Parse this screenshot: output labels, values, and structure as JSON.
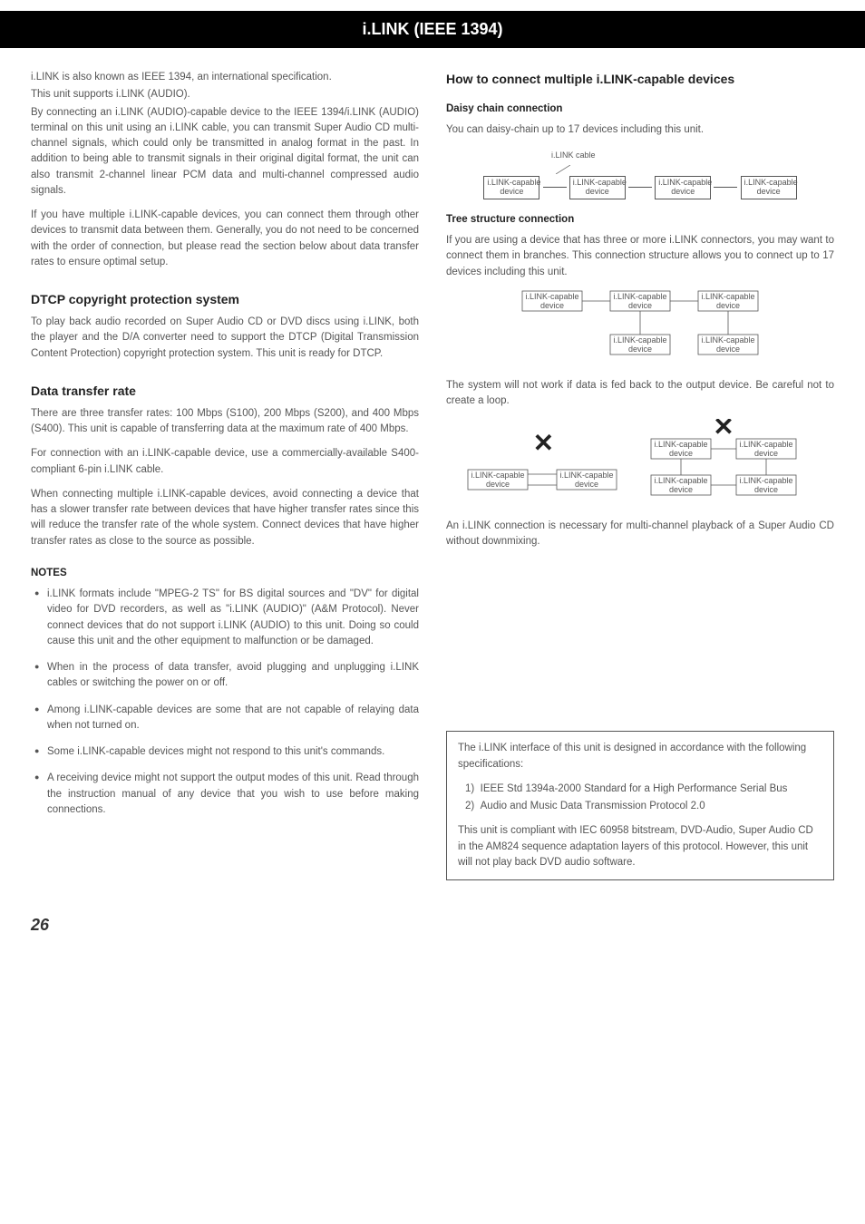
{
  "header": {
    "title": "i.LINK (IEEE 1394)"
  },
  "page_number": "26",
  "left": {
    "intro": [
      "i.LINK is also known as IEEE 1394, an international specification.",
      "This unit supports i.LINK (AUDIO).",
      "By connecting an i.LINK (AUDIO)-capable device to the IEEE 1394/i.LINK (AUDIO) terminal on this unit using an i.LINK cable, you can transmit Super Audio CD multi-channel signals, which could only be transmitted in analog format in the past. In addition to being able to transmit signals in their original digital format, the unit can also transmit 2-channel linear PCM data and multi-channel compressed audio signals.",
      "If you have multiple i.LINK-capable devices, you can connect them through other devices to transmit data between them. Generally, you do not need to be concerned with the order of connection, but please read the section below about data transfer rates to ensure optimal setup."
    ],
    "h_dtcp": "DTCP copyright protection system",
    "p_dtcp": "To play back audio recorded on Super Audio CD or DVD discs using i.LINK, both the player and the D/A converter need to support the DTCP (Digital Transmission Content Protection) copyright protection system. This unit is ready for DTCP.",
    "h_rate": "Data transfer rate",
    "p_rate_1": "There are three transfer rates: 100 Mbps (S100), 200 Mbps (S200), and 400 Mbps (S400). This unit is capable of transferring data at the maximum rate of 400 Mbps.",
    "p_rate_2": "For connection with an i.LINK-capable device, use a commercially-available S400-compliant 6-pin i.LINK cable.",
    "p_rate_3": "When connecting multiple i.LINK-capable devices, avoid connecting a device that has a slower transfer rate between devices that have higher transfer rates since this will reduce the transfer rate of the whole system. Connect devices that have higher transfer rates as close to the source as possible.",
    "notes_head": "NOTES",
    "notes": [
      "i.LINK formats include \"MPEG-2 TS\" for BS digital sources and \"DV\" for digital video for DVD recorders, as well as \"i.LINK (AUDIO)\" (A&M Protocol). Never connect devices that do not support i.LINK (AUDIO) to this unit. Doing so could cause this unit and the other equipment to malfunction or be damaged.",
      "When in the process of data transfer, avoid plugging and unplugging i.LINK cables or switching the power on or off.",
      "Among i.LINK-capable devices are some that are not capable of relaying data when not turned on.",
      "Some i.LINK-capable devices might not respond to this unit's commands.",
      "A receiving device might not support the output modes of this unit. Read through the instruction manual of any device that you wish to use before making connections."
    ]
  },
  "right": {
    "h_connect": "How to connect multiple i.LINK-capable devices",
    "h_daisy": "Daisy chain connection",
    "p_daisy": "You can daisy-chain up to 17 devices including this unit.",
    "h_tree": "Tree structure connection",
    "p_tree": "If you are using a device that has three or more i.LINK connectors, you may want to connect them in branches. This connection structure allows you to connect up to 17 devices including this unit.",
    "p_loop": "The system will not work if data is fed back to the output device. Be careful not to create a loop.",
    "p_mc": "An i.LINK connection is necessary for multi-channel playback of a Super Audio CD without downmixing.",
    "spec": {
      "p1": "The i.LINK interface of this unit is designed in accordance with the following specifications:",
      "items": [
        "IEEE Std 1394a-2000 Standard for a High Performance Serial Bus",
        "Audio and Music Data Transmission Protocol 2.0"
      ],
      "p2": "This unit is compliant with IEC 60958 bitstream, DVD-Audio, Super Audio CD in the AM824 sequence adaptation layers of this protocol. However, this unit will not play back DVD audio software."
    }
  },
  "diagram_labels": {
    "cable": "i.LINK cable",
    "device_l1": "i.LINK-capable",
    "device_l2": "device"
  }
}
